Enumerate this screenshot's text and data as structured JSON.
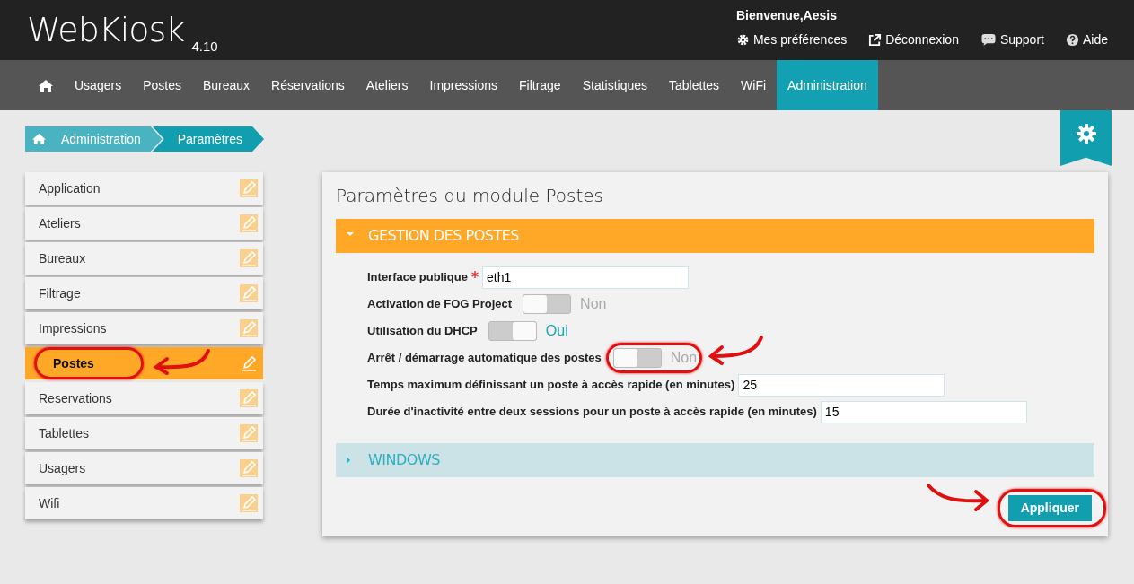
{
  "header": {
    "logo": "WebKiosk",
    "version": "4.10",
    "welcome": "Bienvenue,Aesis",
    "links": [
      {
        "label": "Mes préférences"
      },
      {
        "label": "Déconnexion"
      },
      {
        "label": "Support"
      },
      {
        "label": "Aide"
      }
    ]
  },
  "nav": [
    {
      "label": "Usagers",
      "selected": false
    },
    {
      "label": "Postes",
      "selected": false
    },
    {
      "label": "Bureaux",
      "selected": false
    },
    {
      "label": "Réservations",
      "selected": false
    },
    {
      "label": "Ateliers",
      "selected": false
    },
    {
      "label": "Impressions",
      "selected": false
    },
    {
      "label": "Filtrage",
      "selected": false
    },
    {
      "label": "Statistiques",
      "selected": false
    },
    {
      "label": "Tablettes",
      "selected": false
    },
    {
      "label": "WiFi",
      "selected": false
    },
    {
      "label": "Administration",
      "selected": true
    }
  ],
  "breadcrumb": [
    "Administration",
    "Paramètres"
  ],
  "sidebar": {
    "items": [
      {
        "label": "Application",
        "selected": false,
        "annotated": false
      },
      {
        "label": "Ateliers",
        "selected": false,
        "annotated": false
      },
      {
        "label": "Bureaux",
        "selected": false,
        "annotated": false
      },
      {
        "label": "Filtrage",
        "selected": false,
        "annotated": false
      },
      {
        "label": "Impressions",
        "selected": false,
        "annotated": false
      },
      {
        "label": "Postes",
        "selected": true,
        "annotated": true
      },
      {
        "label": "Reservations",
        "selected": false,
        "annotated": false
      },
      {
        "label": "Tablettes",
        "selected": false,
        "annotated": false
      },
      {
        "label": "Usagers",
        "selected": false,
        "annotated": false
      },
      {
        "label": "Wifi",
        "selected": false,
        "annotated": false
      }
    ]
  },
  "panel": {
    "title": "Paramètres du module Postes",
    "sections": [
      {
        "title": "GESTION DES POSTES",
        "expanded": true,
        "fields": [
          {
            "kind": "text",
            "label": "Interface publique",
            "required": true,
            "value": "eth1",
            "annotated": false
          },
          {
            "kind": "toggle",
            "label": "Activation de FOG Project",
            "required": false,
            "on": false,
            "state_label": "Non",
            "annotated": false
          },
          {
            "kind": "toggle",
            "label": "Utilisation du DHCP",
            "required": false,
            "on": true,
            "state_label": "Oui",
            "annotated": false
          },
          {
            "kind": "toggle",
            "label": "Arrêt / démarrage automatique des postes",
            "required": false,
            "on": false,
            "state_label": "Non",
            "annotated": true
          },
          {
            "kind": "text",
            "label": "Temps maximum définissant un poste à accès rapide (en minutes)",
            "required": false,
            "value": "25",
            "annotated": false
          },
          {
            "kind": "text",
            "label": "Durée d'inactivité entre deux sessions pour un poste à accès rapide (en minutes)",
            "required": false,
            "value": "15",
            "annotated": false
          }
        ]
      },
      {
        "title": "WINDOWS",
        "expanded": false
      }
    ],
    "apply_button": {
      "label": "Appliquer",
      "annotated": true
    }
  }
}
